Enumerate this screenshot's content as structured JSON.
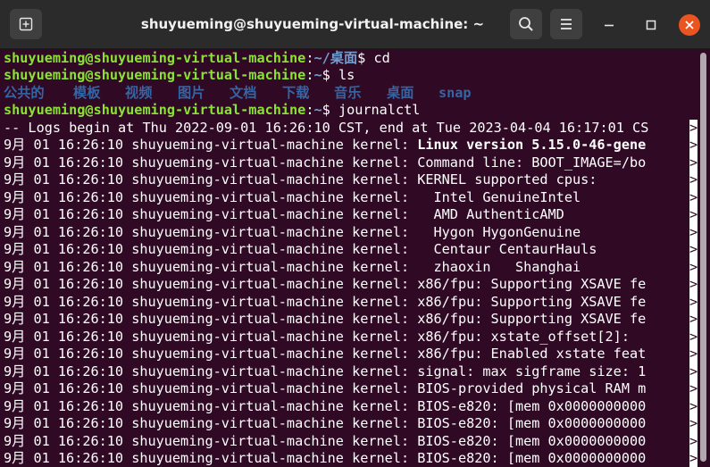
{
  "window": {
    "title": "shuyueming@shuyueming-virtual-machine: ~"
  },
  "icons": {
    "new_tab": "new-tab-icon",
    "search": "search-icon",
    "menu": "hamburger-menu-icon",
    "minimize": "minimize-icon",
    "maximize": "maximize-icon",
    "close": "close-icon"
  },
  "colors": {
    "terminal_bg": "#300a24",
    "prompt_user": "#8ae234",
    "prompt_path": "#729fcf",
    "directory": "#3465a4",
    "close_button": "#e95420"
  },
  "terminal": {
    "prompt_user": "shuyueming@shuyueming-virtual-machine",
    "prompt_sep": ":",
    "prompt_dollar": "$ ",
    "lines": [
      {
        "kind": "prompt",
        "path": "~/桌面",
        "cmd": "cd"
      },
      {
        "kind": "prompt",
        "path": "~",
        "cmd": "ls"
      },
      {
        "kind": "dirs",
        "items": [
          "公共的",
          "模板",
          "视频",
          "图片",
          "文档",
          "下载",
          "音乐",
          "桌面",
          "snap"
        ]
      },
      {
        "kind": "prompt",
        "path": "~",
        "cmd": "journalctl"
      },
      {
        "kind": "text",
        "text": "-- Logs begin at Thu 2022-09-01 16:26:10 CST, end at Tue 2023-04-04 16:17:01 CS"
      },
      {
        "kind": "log",
        "prefix": "9月 01 16:26:10 shuyueming-virtual-machine kernel: ",
        "msg": "Linux version 5.15.0-46-gene",
        "bold": true
      },
      {
        "kind": "log",
        "prefix": "9月 01 16:26:10 shuyueming-virtual-machine kernel: ",
        "msg": "Command line: BOOT_IMAGE=/bo"
      },
      {
        "kind": "log",
        "prefix": "9月 01 16:26:10 shuyueming-virtual-machine kernel: ",
        "msg": "KERNEL supported cpus:"
      },
      {
        "kind": "log",
        "prefix": "9月 01 16:26:10 shuyueming-virtual-machine kernel: ",
        "msg": "  Intel GenuineIntel"
      },
      {
        "kind": "log",
        "prefix": "9月 01 16:26:10 shuyueming-virtual-machine kernel: ",
        "msg": "  AMD AuthenticAMD"
      },
      {
        "kind": "log",
        "prefix": "9月 01 16:26:10 shuyueming-virtual-machine kernel: ",
        "msg": "  Hygon HygonGenuine"
      },
      {
        "kind": "log",
        "prefix": "9月 01 16:26:10 shuyueming-virtual-machine kernel: ",
        "msg": "  Centaur CentaurHauls"
      },
      {
        "kind": "log",
        "prefix": "9月 01 16:26:10 shuyueming-virtual-machine kernel: ",
        "msg": "  zhaoxin   Shanghai"
      },
      {
        "kind": "log",
        "prefix": "9月 01 16:26:10 shuyueming-virtual-machine kernel: ",
        "msg": "x86/fpu: Supporting XSAVE fe"
      },
      {
        "kind": "log",
        "prefix": "9月 01 16:26:10 shuyueming-virtual-machine kernel: ",
        "msg": "x86/fpu: Supporting XSAVE fe"
      },
      {
        "kind": "log",
        "prefix": "9月 01 16:26:10 shuyueming-virtual-machine kernel: ",
        "msg": "x86/fpu: Supporting XSAVE fe"
      },
      {
        "kind": "log",
        "prefix": "9月 01 16:26:10 shuyueming-virtual-machine kernel: ",
        "msg": "x86/fpu: xstate_offset[2]:"
      },
      {
        "kind": "log",
        "prefix": "9月 01 16:26:10 shuyueming-virtual-machine kernel: ",
        "msg": "x86/fpu: Enabled xstate feat"
      },
      {
        "kind": "log",
        "prefix": "9月 01 16:26:10 shuyueming-virtual-machine kernel: ",
        "msg": "signal: max sigframe size: 1"
      },
      {
        "kind": "log",
        "prefix": "9月 01 16:26:10 shuyueming-virtual-machine kernel: ",
        "msg": "BIOS-provided physical RAM m"
      },
      {
        "kind": "log",
        "prefix": "9月 01 16:26:10 shuyueming-virtual-machine kernel: ",
        "msg": "BIOS-e820: [mem 0x0000000000"
      },
      {
        "kind": "log",
        "prefix": "9月 01 16:26:10 shuyueming-virtual-machine kernel: ",
        "msg": "BIOS-e820: [mem 0x0000000000"
      },
      {
        "kind": "log",
        "prefix": "9月 01 16:26:10 shuyueming-virtual-machine kernel: ",
        "msg": "BIOS-e820: [mem 0x0000000000"
      },
      {
        "kind": "log",
        "prefix": "9月 01 16:26:10 shuyueming-virtual-machine kernel: ",
        "msg": "BIOS-e820: [mem 0x0000000000"
      }
    ],
    "truncation_marker": ">"
  }
}
